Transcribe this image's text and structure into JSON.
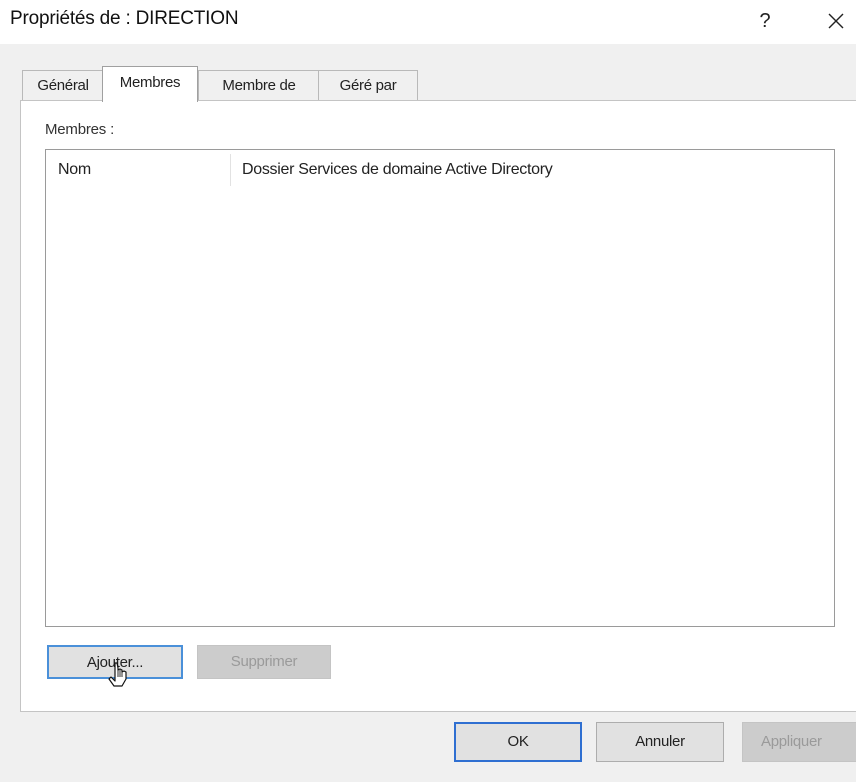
{
  "window": {
    "title": "Propriétés de : DIRECTION",
    "help_label": "?"
  },
  "tabs": [
    {
      "label": "Général",
      "active": false
    },
    {
      "label": "Membres",
      "active": true
    },
    {
      "label": "Membre de",
      "active": false
    },
    {
      "label": "Géré par",
      "active": false
    }
  ],
  "members": {
    "label": "Membres :",
    "columns": [
      "Nom",
      "Dossier Services de domaine Active Directory"
    ],
    "rows": [],
    "add_label": "Ajouter...",
    "remove_label": "Supprimer"
  },
  "footer": {
    "ok_label": "OK",
    "cancel_label": "Annuler",
    "apply_label": "Appliquer"
  },
  "icons": {
    "close": "close-icon",
    "cursor": "mouse-cursor-icon"
  },
  "colors": {
    "focus_border": "#4a90d9",
    "default_button_border": "#2f6fd1",
    "disabled_text": "#9a9a9a"
  }
}
